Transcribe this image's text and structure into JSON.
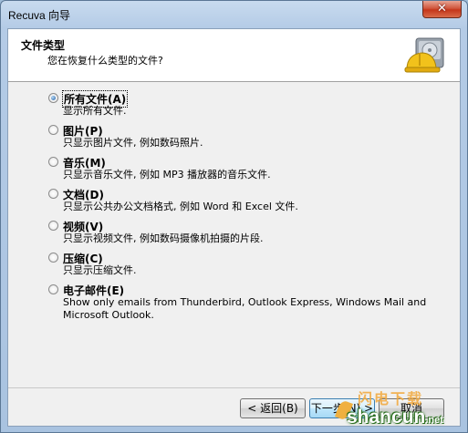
{
  "window": {
    "title": "Recuva 向导",
    "close_label": "✕"
  },
  "header": {
    "title": "文件类型",
    "subtitle": "您在恢复什么类型的文件?"
  },
  "options": [
    {
      "label": "所有文件(A)",
      "desc": "显示所有文件.",
      "checked": true
    },
    {
      "label": "图片(P)",
      "desc": "只显示图片文件, 例如数码照片.",
      "checked": false
    },
    {
      "label": "音乐(M)",
      "desc": "只显示音乐文件, 例如 MP3 播放器的音乐文件.",
      "checked": false
    },
    {
      "label": "文档(D)",
      "desc": "只显示公共办公文档格式, 例如 Word 和 Excel 文件.",
      "checked": false
    },
    {
      "label": "视频(V)",
      "desc": "只显示视频文件, 例如数码摄像机拍摄的片段.",
      "checked": false
    },
    {
      "label": "压缩(C)",
      "desc": "只显示压缩文件.",
      "checked": false
    },
    {
      "label": "电子邮件(E)",
      "desc": "Show only emails from Thunderbird, Outlook Express, Windows Mail and Microsoft Outlook.",
      "checked": false
    }
  ],
  "buttons": {
    "back": "< 返回(B)",
    "next": "下一步(N) >",
    "cancel": "取消"
  },
  "watermark": {
    "top": "闪电下载",
    "main": "shancun",
    "net": ".net"
  },
  "icons": {
    "logo": "recuva-hardhat-drive-icon"
  },
  "colors": {
    "accent": "#3c7fb1",
    "header_bg": "#ffffff",
    "client_bg": "#f0f0f0",
    "close": "#c4361a"
  }
}
